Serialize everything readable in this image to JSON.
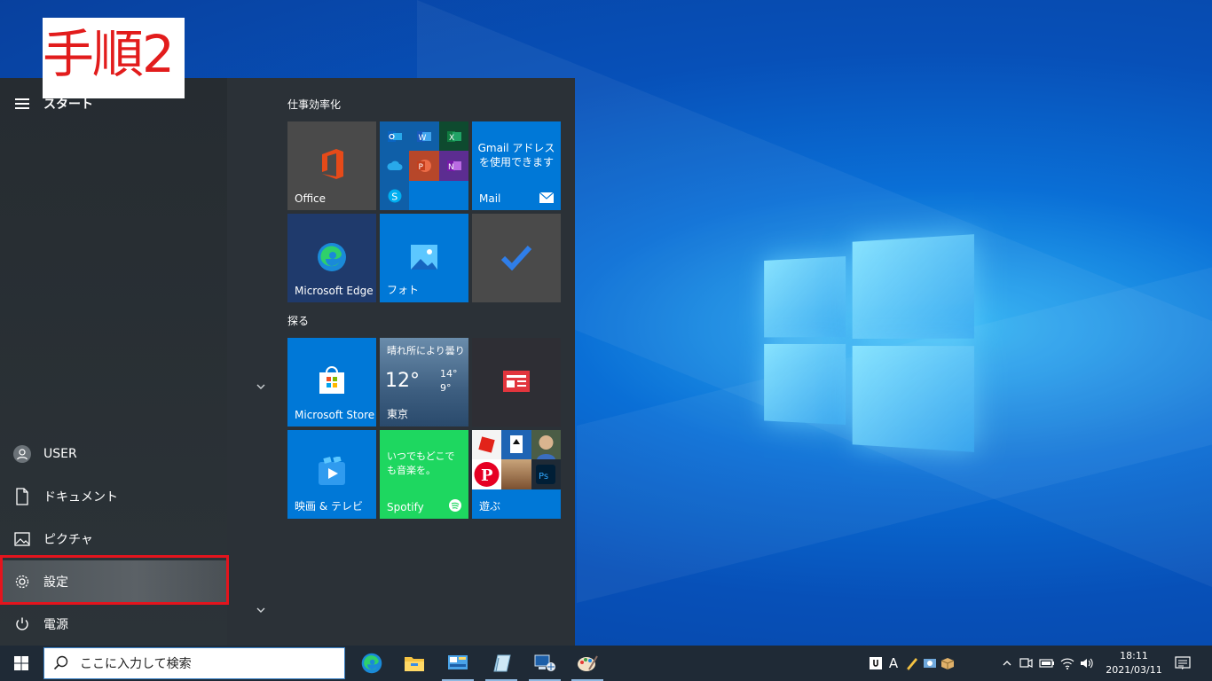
{
  "step_label": "手順2",
  "start_menu": {
    "title": "スタート",
    "rail_items": [
      {
        "label": "USER",
        "icon": "user-avatar-icon"
      },
      {
        "label": "ドキュメント",
        "icon": "document-icon"
      },
      {
        "label": "ピクチャ",
        "icon": "picture-icon"
      },
      {
        "label": "設定",
        "icon": "gear-icon",
        "highlighted": true
      },
      {
        "label": "電源",
        "icon": "power-icon"
      }
    ],
    "groups": [
      {
        "title": "仕事効率化"
      },
      {
        "title": "探る"
      }
    ],
    "tiles": {
      "office": "Office",
      "mail_message": "Gmail アドレスを使用できます",
      "mail": "Mail",
      "edge": "Microsoft Edge",
      "photos": "フォト",
      "store": "Microsoft Store",
      "weather_cond": "晴れ所により曇り",
      "weather_temp": "12°",
      "weather_high": "14°",
      "weather_low": "9°",
      "weather_city": "東京",
      "movies": "映画 & テレビ",
      "spotify_message": "いつでもどこでも音楽を。",
      "spotify": "Spotify",
      "play": "遊ぶ"
    }
  },
  "taskbar": {
    "search_placeholder": "ここに入力して検索",
    "ime_label": "A",
    "clock_time": "18:11",
    "clock_date": "2021/03/11"
  },
  "colors": {
    "accent_tile": "#0078d7",
    "highlight_box": "#e4141d",
    "spotify_green": "#1ed760",
    "start_bg": "#2b3137"
  }
}
